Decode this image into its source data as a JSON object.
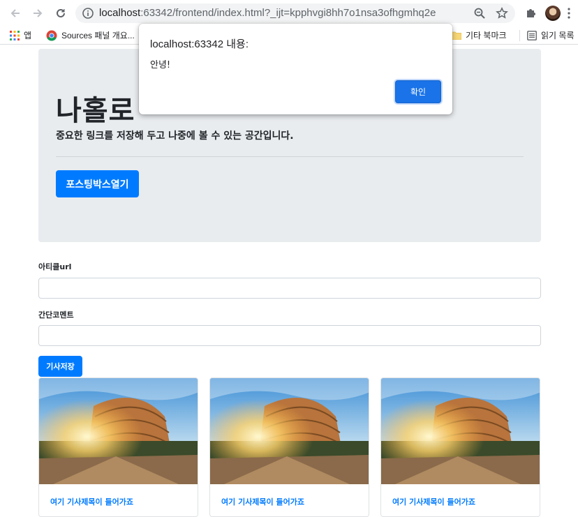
{
  "browser": {
    "url_host": "localhost",
    "url_rest": ":63342/frontend/index.html?_ijt=kpphvgi8hh7o1nsa3ofhgmhq2e",
    "bookmarks": {
      "apps_label": "앱",
      "sources_label": "Sources 패널 개요...",
      "other_label": "기타 북마크",
      "reading_label": "읽기 목록"
    }
  },
  "dialog": {
    "title": "localhost:63342 내용:",
    "message": "안녕!",
    "ok_label": "확인"
  },
  "jumbotron": {
    "title": "나홀로",
    "lead": "중요한 링크를 저장해 두고 나중에 볼 수 있는 공간입니다.",
    "open_button": "포스팅박스열기"
  },
  "form": {
    "url_label": "아티클url",
    "comment_label": "간단코멘트",
    "save_button": "기사저장",
    "url_value": "",
    "comment_value": ""
  },
  "cards": [
    {
      "title": "여기 기사제목이 들어가죠",
      "image": "colosseum-photo"
    },
    {
      "title": "여기 기사제목이 들어가죠",
      "image": "colosseum-photo"
    },
    {
      "title": "여기 기사제목이 들어가죠",
      "image": "colosseum-photo"
    }
  ],
  "colors": {
    "primary": "#007bff",
    "dialog_button": "#1a73e8",
    "jumbotron_bg": "#e9ecef"
  }
}
